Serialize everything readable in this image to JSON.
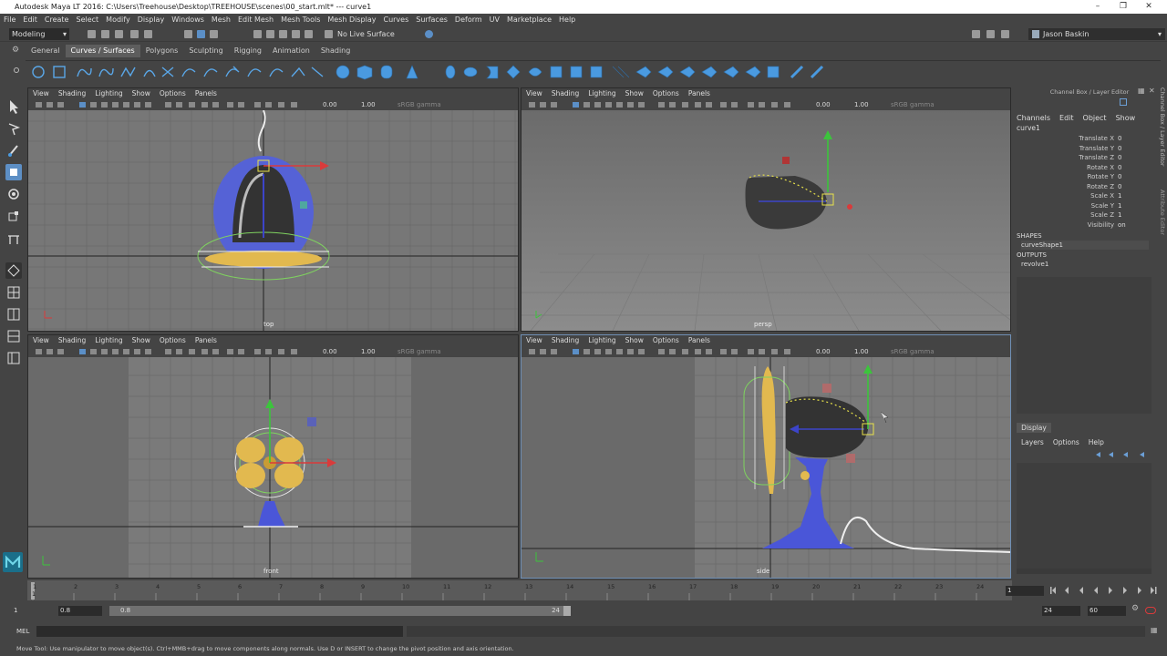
{
  "window": {
    "title": "Autodesk Maya LT 2016: C:\\Users\\Treehouse\\Desktop\\TREEHOUSE\\scenes\\00_start.mlt*   ---   curve1"
  },
  "menubar": [
    "File",
    "Edit",
    "Create",
    "Select",
    "Modify",
    "Display",
    "Windows",
    "Mesh",
    "Edit Mesh",
    "Mesh Tools",
    "Mesh Display",
    "Curves",
    "Surfaces",
    "Deform",
    "UV",
    "Marketplace",
    "Help"
  ],
  "status": {
    "mode": "Modeling",
    "live_surface": "No Live Surface",
    "user": "Jason Baskin"
  },
  "shelf_tabs": [
    "General",
    "Curves / Surfaces",
    "Polygons",
    "Sculpting",
    "Rigging",
    "Animation",
    "Shading"
  ],
  "shelf_active": "Curves / Surfaces",
  "viewport_menu": [
    "View",
    "Shading",
    "Lighting",
    "Show",
    "Options",
    "Panels"
  ],
  "viewports": [
    {
      "label": "top",
      "val1": "0.00",
      "val2": "1.00",
      "gamma": "sRGB gamma"
    },
    {
      "label": "persp",
      "val1": "0.00",
      "val2": "1.00",
      "gamma": "sRGB gamma"
    },
    {
      "label": "front",
      "val1": "0.00",
      "val2": "1.00",
      "gamma": "sRGB gamma"
    },
    {
      "label": "side",
      "val1": "0.00",
      "val2": "1.00",
      "gamma": "sRGB gamma"
    }
  ],
  "channel_box": {
    "title": "Channel Box / Layer Editor",
    "menu": [
      "Channels",
      "Edit",
      "Object",
      "Show"
    ],
    "object": "curve1",
    "attrs": [
      {
        "name": "Translate X",
        "value": "0"
      },
      {
        "name": "Translate Y",
        "value": "0"
      },
      {
        "name": "Translate Z",
        "value": "0"
      },
      {
        "name": "Rotate X",
        "value": "0"
      },
      {
        "name": "Rotate Y",
        "value": "0"
      },
      {
        "name": "Rotate Z",
        "value": "0"
      },
      {
        "name": "Scale X",
        "value": "1"
      },
      {
        "name": "Scale Y",
        "value": "1"
      },
      {
        "name": "Scale Z",
        "value": "1"
      },
      {
        "name": "Visibility",
        "value": "on"
      }
    ],
    "shapes_header": "SHAPES",
    "shape": "curveShape1",
    "outputs_header": "OUTPUTS",
    "output": "revolve1",
    "display_tab": "Display",
    "layer_menu": [
      "Layers",
      "Options",
      "Help"
    ],
    "side_tabs": [
      "Channel Box / Layer Editor",
      "Attribute Editor"
    ]
  },
  "timeline": {
    "ticks": [
      "1",
      "2",
      "3",
      "4",
      "5",
      "6",
      "7",
      "8",
      "9",
      "10",
      "11",
      "12",
      "13",
      "14",
      "15",
      "16",
      "17",
      "18",
      "19",
      "20",
      "21",
      "22",
      "23",
      "24"
    ],
    "current": "1",
    "current_frame": "1"
  },
  "range": {
    "start": "1",
    "start_inner": "0.8",
    "range_inner": "0.8",
    "range_end": "24",
    "end": "24",
    "end_outer": "60"
  },
  "cmdline": {
    "label": "MEL"
  },
  "helpline": "Move Tool: Use manipulator to move object(s). Ctrl+MMB+drag to move components along normals. Use D or INSERT to change the pivot position and axis orientation."
}
